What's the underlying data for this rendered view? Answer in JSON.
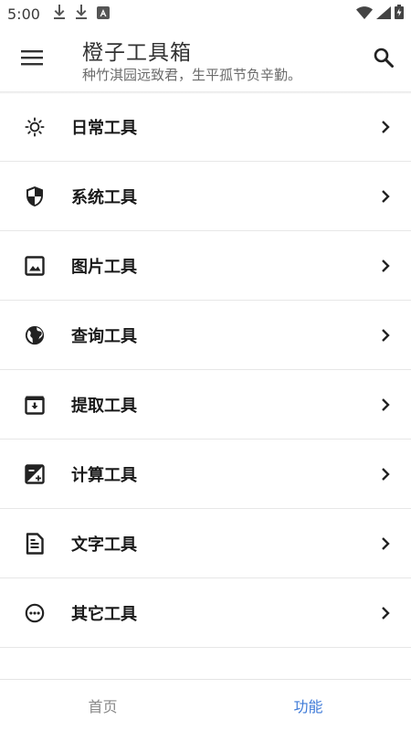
{
  "status_bar": {
    "time": "5:00",
    "left_icons": [
      "download-icon",
      "download-icon",
      "app-notification-icon"
    ],
    "right_icons": [
      "wifi-icon",
      "signal-icon",
      "battery-icon"
    ]
  },
  "app_bar": {
    "title": "橙子工具箱",
    "subtitle": "种竹淇园远致君，生平孤节负辛勤。",
    "menu_icon": "hamburger-menu-icon",
    "search_icon": "search-icon"
  },
  "tools": [
    {
      "label": "日常工具",
      "icon": "brightness-icon"
    },
    {
      "label": "系统工具",
      "icon": "shield-icon"
    },
    {
      "label": "图片工具",
      "icon": "image-icon"
    },
    {
      "label": "查询工具",
      "icon": "globe-icon"
    },
    {
      "label": "提取工具",
      "icon": "archive-icon"
    },
    {
      "label": "计算工具",
      "icon": "calculator-icon"
    },
    {
      "label": "文字工具",
      "icon": "document-icon"
    },
    {
      "label": "其它工具",
      "icon": "more-icon"
    }
  ],
  "bottom_nav": {
    "items": [
      {
        "label": "首页",
        "active": false
      },
      {
        "label": "功能",
        "active": true
      }
    ]
  },
  "colors": {
    "accent": "#3f7bd8",
    "text_primary": "#1a1a1a",
    "text_secondary": "#6b6b6b",
    "divider": "#e7e7e7"
  }
}
